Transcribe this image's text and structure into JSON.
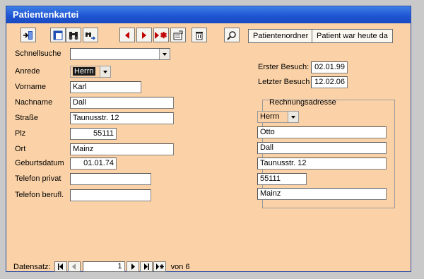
{
  "window": {
    "title": "Patientenkartei"
  },
  "toolbar": {
    "buttons": [
      "close-form",
      "open-form",
      "find",
      "replace",
      "previous-record",
      "next-record",
      "new-record",
      "properties",
      "delete",
      "search"
    ],
    "patient_folder_label": "Patientenordner",
    "patient_today_label": "Patient war heute da"
  },
  "form": {
    "schnellsuche_label": "Schnellsuche",
    "schnellsuche_value": "",
    "anrede_label": "Anrede",
    "anrede_value": "Herrn",
    "vorname_label": "Vorname",
    "vorname_value": "Karl",
    "nachname_label": "Nachname",
    "nachname_value": "Dall",
    "strasse_label": "Straße",
    "strasse_value": "Taunusstr. 12",
    "plz_label": "Plz",
    "plz_value": "55111",
    "ort_label": "Ort",
    "ort_value": "Mainz",
    "geburtsdatum_label": "Geburtsdatum",
    "geburtsdatum_value": "01.01.74",
    "telefon_privat_label": "Telefon privat",
    "telefon_privat_value": "",
    "telefon_beruf_label": "Telefon berufl.",
    "telefon_beruf_value": ""
  },
  "visits": {
    "erster_label": "Erster Besuch:",
    "erster_value": "02.01.99",
    "letzter_label": "Letzter Besuch",
    "letzter_value": "12.02.06"
  },
  "rechnungsadresse": {
    "title": "Rechnungsadresse",
    "anrede": "Herrn",
    "vorname": "Otto",
    "nachname": "Dall",
    "strasse": "Taunusstr. 12",
    "plz": "55111",
    "ort": "Mainz"
  },
  "navigation": {
    "label": "Datensatz:",
    "current": "1",
    "total_text": "von 6"
  },
  "colors": {
    "form_bg": "#fbd2a7",
    "title_bar": "#1f56d4",
    "arrow_red": "#c00000"
  }
}
